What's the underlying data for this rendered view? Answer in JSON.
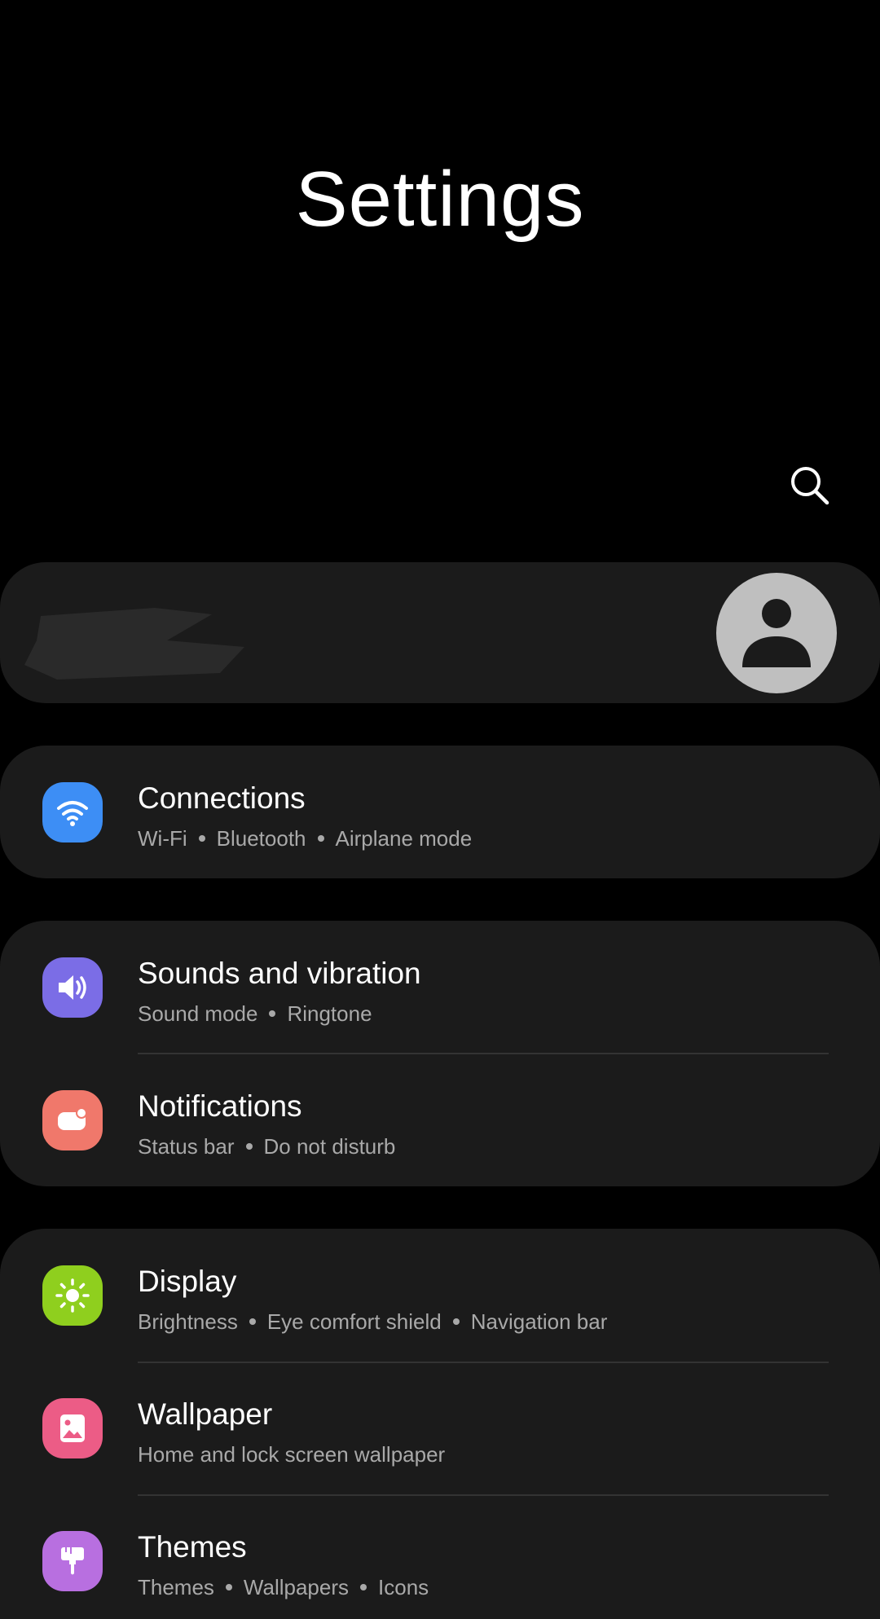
{
  "header": {
    "title": "Settings"
  },
  "icons": {
    "search": "search-icon",
    "profile": "profile-icon"
  },
  "groups": [
    {
      "items": [
        {
          "title": "Connections",
          "subtitle": [
            "Wi-Fi",
            "Bluetooth",
            "Airplane mode"
          ],
          "icon": "wifi-icon",
          "color": "#3d8ef5"
        }
      ]
    },
    {
      "items": [
        {
          "title": "Sounds and vibration",
          "subtitle": [
            "Sound mode",
            "Ringtone"
          ],
          "icon": "speaker-icon",
          "color": "#7b6de6"
        },
        {
          "title": "Notifications",
          "subtitle": [
            "Status bar",
            "Do not disturb"
          ],
          "icon": "notification-icon",
          "color": "#f0786b"
        }
      ]
    },
    {
      "items": [
        {
          "title": "Display",
          "subtitle": [
            "Brightness",
            "Eye comfort shield",
            "Navigation bar"
          ],
          "icon": "brightness-icon",
          "color": "#8fcf1e"
        },
        {
          "title": "Wallpaper",
          "subtitle": [
            "Home and lock screen wallpaper"
          ],
          "icon": "wallpaper-icon",
          "color": "#ec5c86"
        },
        {
          "title": "Themes",
          "subtitle": [
            "Themes",
            "Wallpapers",
            "Icons"
          ],
          "icon": "theme-brush-icon",
          "color": "#b86fe0"
        }
      ]
    }
  ]
}
